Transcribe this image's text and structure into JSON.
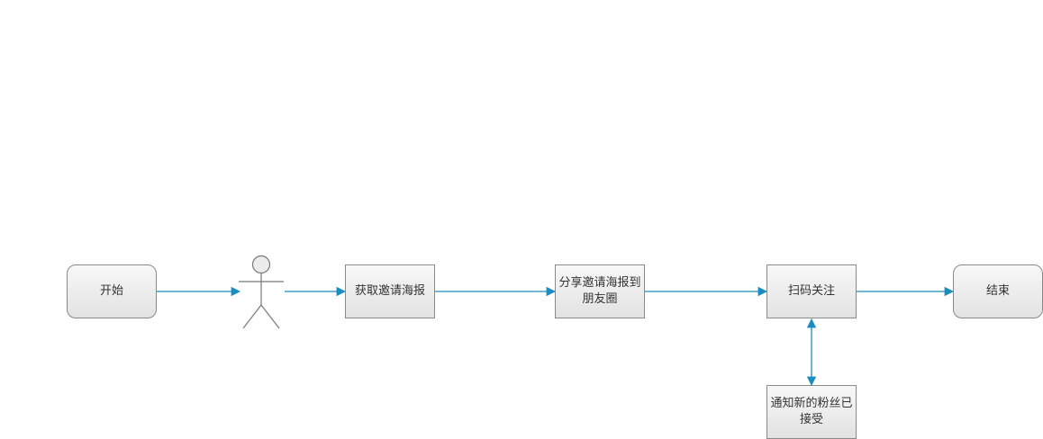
{
  "diagram": {
    "colors": {
      "connector": "#1a8cc0",
      "node_border": "#8a8a8a",
      "actor": "#777777"
    },
    "nodes": {
      "start": {
        "label": "开始"
      },
      "get_poster": {
        "label": "获取邀请海报"
      },
      "share_poster": {
        "label": "分享邀请海报到\n朋友圈"
      },
      "scan_follow": {
        "label": "扫码关注"
      },
      "end": {
        "label": "结束"
      },
      "notify": {
        "label": "通知新的粉丝已\n接受"
      }
    },
    "actor": {
      "icon": "user-icon"
    },
    "edges": [
      {
        "from": "start",
        "to": "actor"
      },
      {
        "from": "actor",
        "to": "get_poster"
      },
      {
        "from": "get_poster",
        "to": "share_poster"
      },
      {
        "from": "share_poster",
        "to": "scan_follow"
      },
      {
        "from": "scan_follow",
        "to": "end"
      },
      {
        "from": "scan_follow",
        "to": "notify",
        "bidirectional": true
      }
    ]
  }
}
